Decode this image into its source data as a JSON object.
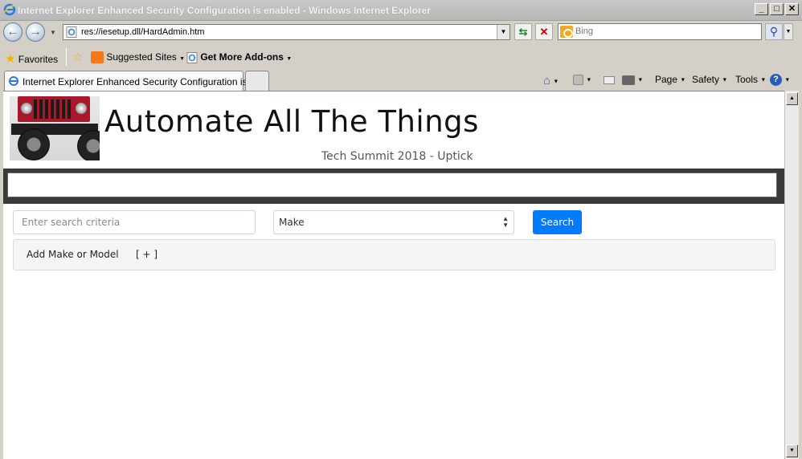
{
  "window": {
    "title": "Internet Explorer Enhanced Security Configuration is enabled - Windows Internet Explorer",
    "minimize": "_",
    "maximize": "□",
    "close": "✕"
  },
  "address": {
    "url": "res://iesetup.dll/HardAdmin.htm",
    "search_placeholder": "Bing"
  },
  "favorites": {
    "favorites_label": "Favorites",
    "suggested_label": "Suggested Sites",
    "addons_label": "Get More Add-ons"
  },
  "tabs": {
    "active_label": "Internet Explorer Enhanced Security Configuration is ..."
  },
  "commands": {
    "page": "Page",
    "safety": "Safety",
    "tools": "Tools"
  },
  "site": {
    "title": "Automate All The Things",
    "subtitle": "Tech Summit 2018 - Uptick",
    "search_placeholder": "Enter search criteria",
    "make_value": "Make",
    "search_button": "Search",
    "add_label": "Add Make or Model",
    "add_toggle": "[ + ]"
  },
  "colors": {
    "accent": "#007bff",
    "banner": "#3a3a3a",
    "jeep": "#a8182a"
  }
}
